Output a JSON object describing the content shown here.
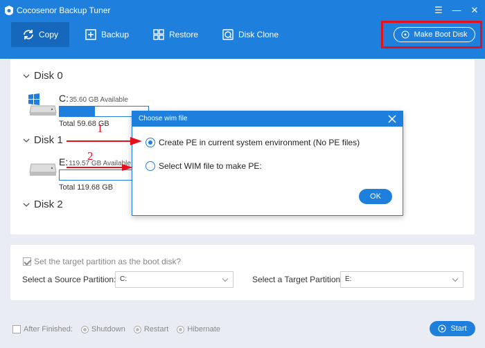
{
  "app": {
    "title": "Cocosenor Backup Tuner"
  },
  "window_controls": {
    "menu": "☰",
    "minimize": "—",
    "close": "✕"
  },
  "toolbar": {
    "items": [
      {
        "label": "Copy",
        "icon": "copy-sync-icon",
        "active": true
      },
      {
        "label": "Backup",
        "icon": "backup-icon",
        "active": false
      },
      {
        "label": "Restore",
        "icon": "restore-icon",
        "active": false
      },
      {
        "label": "Disk Clone",
        "icon": "disk-clone-icon",
        "active": false
      }
    ],
    "make_boot_disk": "Make Boot Disk"
  },
  "disks": [
    {
      "name": "Disk 0",
      "partition": {
        "letter": "C:",
        "available": "35.60 GB Available",
        "total": "Total 59.68 GB",
        "used_fraction": 0.4,
        "icon": "windows-drive-icon"
      }
    },
    {
      "name": "Disk 1",
      "partition": {
        "letter": "E:",
        "available": "119.57 GB Available",
        "total": "Total 119.68 GB",
        "used_fraction": 0.0,
        "icon": "drive-icon"
      }
    },
    {
      "name": "Disk 2"
    }
  ],
  "options": {
    "set_boot_label": "Set the target partition as the boot disk?",
    "set_boot_checked": true,
    "source_label": "Select a Source Partition:",
    "source_value": "C:",
    "target_label": "Select a Target Partition:",
    "target_value": "E:"
  },
  "footer": {
    "after_finished": "After Finished:",
    "after_checked": false,
    "choices": [
      "Shutdown",
      "Restart",
      "Hibernate"
    ],
    "start": "Start"
  },
  "dialog": {
    "title": "Choose wim file",
    "option1": "Create PE in current system environment (No PE files)",
    "option1_selected": true,
    "option2": "Select WIM file to make PE:",
    "option2_selected": false,
    "ok": "OK"
  },
  "annotations": {
    "num1": "1",
    "num2": "2"
  },
  "colors": {
    "primary": "#1f7fdc",
    "annotation": "#e5101b",
    "background": "#e9edf3"
  }
}
